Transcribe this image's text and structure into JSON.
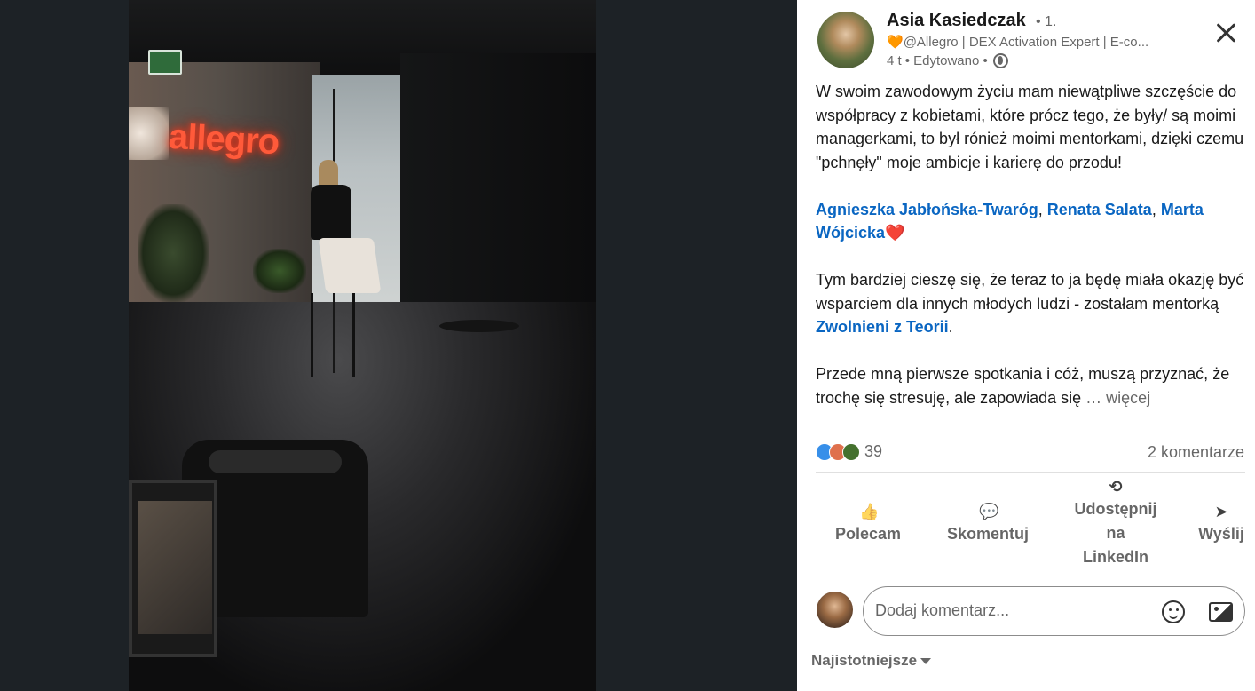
{
  "media": {
    "photo_alt": "",
    "neon_sign": "allegro"
  },
  "post": {
    "author": {
      "name": "Asia Kasiedczak",
      "degree": "• 1.",
      "headline_emoji": "🧡",
      "headline": "@Allegro | DEX Activation Expert | E-co...",
      "time": "4 t",
      "edited": "• Edytowano •"
    },
    "body": {
      "p1": "W swoim zawodowym życiu mam niewątpliwe szczęście do współpracy z kobietami, które prócz tego, że były/ są moimi managerkami, to był rónież moimi mentorkami, dzięki czemu \"pchnęły\" moje ambicje i karierę do przodu!",
      "mention1": "Agnieszka Jabłońska-Twaróg",
      "sep1": ", ",
      "mention2": "Renata Salata",
      "sep2": ", ",
      "mention3": "Marta Wójcicka",
      "heart": "❤️",
      "p3_start": "Tym bardziej cieszę się, że teraz to ja będę miała okazję być wsparciem dla innych młodych ludzi - zostałam mentorką ",
      "mention4": "Zwolnieni z Teorii",
      "p3_end": ".",
      "p4": "Przede mną pierwsze spotkania i cóż, muszą przyznać, że trochę się stresuję, ale zapowiada się ",
      "more": " … więcej"
    },
    "reactions": {
      "count": "39",
      "types": [
        "like-icon",
        "love-icon",
        "support-icon"
      ],
      "colors": {
        "like": "#378fe9",
        "love": "#df704d",
        "support": "#44712e"
      }
    },
    "comments_count": "2 komentarze",
    "actions": {
      "like": "Polecam",
      "comment": "Skomentuj",
      "share_l1": "Udostępnij",
      "share_l2": "na",
      "share_l3": "LinkedIn",
      "send": "Wyślij"
    },
    "comment_box": {
      "placeholder": "Dodaj komentarz..."
    },
    "sort": {
      "label": "Najistotniejsze"
    }
  },
  "theme": {
    "accent": "#0a66c2",
    "viewer_bg": "#1d2226"
  }
}
